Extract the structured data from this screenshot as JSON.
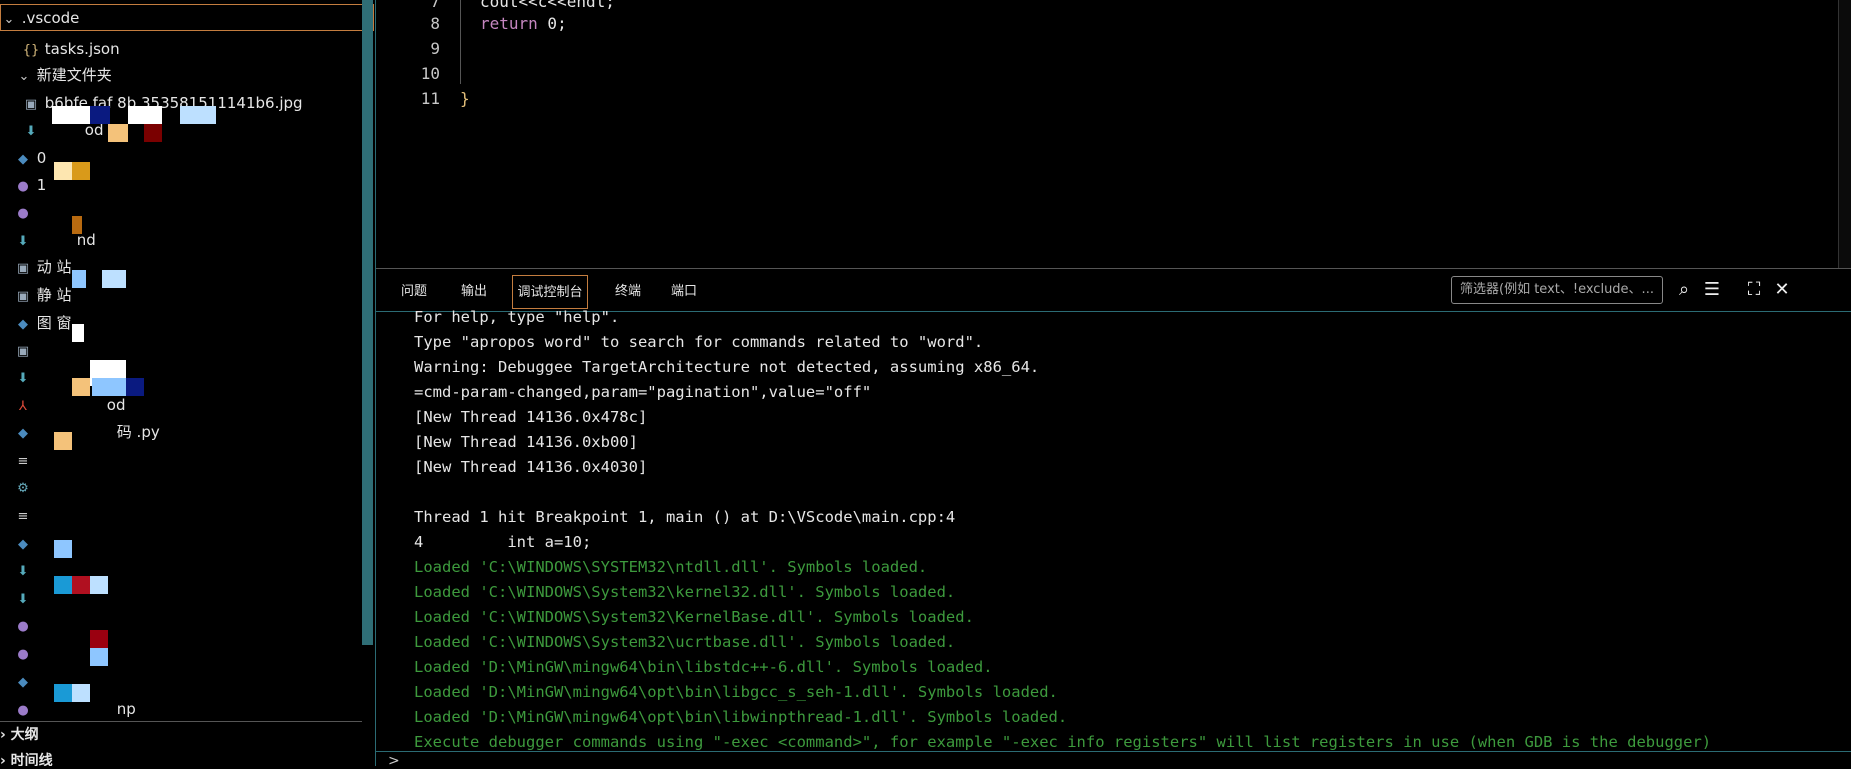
{
  "explorer": {
    "items": [
      {
        "label": ".vscode",
        "icon": "chevron-down-icon"
      },
      {
        "label": "tasks.json",
        "icon": "json-icon"
      },
      {
        "label": "新建文件夹",
        "icon": "chevron-down-icon"
      },
      {
        "label": "b6bfe  faf  8b  353581511141b6.jpg",
        "icon": "image-icon"
      },
      {
        "label": "od",
        "icon": "download-icon"
      },
      {
        "label": "0",
        "icon": "python-icon"
      },
      {
        "label": "1",
        "icon": "php-icon"
      },
      {
        "label": "nd",
        "icon": "download-icon"
      },
      {
        "label": "动  站",
        "icon": "image-icon"
      },
      {
        "label": "静  站",
        "icon": "image-icon"
      },
      {
        "label": "图  窗",
        "icon": "python-icon"
      },
      {
        "label": "od",
        "icon": "pdf-icon"
      },
      {
        "label": "码  .py",
        "icon": "python-icon"
      },
      {
        "label": "np",
        "icon": "php-icon"
      }
    ],
    "outline_label": "大纲",
    "timeline_label": "时间线"
  },
  "editor": {
    "lines": [
      {
        "num": "7",
        "text": "cout<<c<<endl;"
      },
      {
        "num": "8",
        "kw": "return",
        "rest": " 0;"
      },
      {
        "num": "9",
        "text": ""
      },
      {
        "num": "10",
        "text": ""
      },
      {
        "num": "11",
        "text": "}"
      }
    ]
  },
  "panel": {
    "tabs": [
      "问题",
      "输出",
      "调试控制台",
      "终端",
      "端口"
    ],
    "active_tab": "调试控制台",
    "filter_placeholder": "筛选器(例如 text、!exclude、...",
    "output": [
      {
        "text": "For help, type \"help\".",
        "color": "white"
      },
      {
        "text": "Type \"apropos word\" to search for commands related to \"word\".",
        "color": "white"
      },
      {
        "text": "Warning: Debuggee TargetArchitecture not detected, assuming x86_64.",
        "color": "white"
      },
      {
        "text": "=cmd-param-changed,param=\"pagination\",value=\"off\"",
        "color": "white"
      },
      {
        "text": "[New Thread 14136.0x478c]",
        "color": "white"
      },
      {
        "text": "[New Thread 14136.0xb00]",
        "color": "white"
      },
      {
        "text": "[New Thread 14136.0x4030]",
        "color": "white"
      },
      {
        "text": "",
        "color": "white"
      },
      {
        "text": "Thread 1 hit Breakpoint 1, main () at D:\\VScode\\main.cpp:4",
        "color": "white"
      },
      {
        "text": "4         int a=10;",
        "color": "white"
      },
      {
        "text": "Loaded 'C:\\WINDOWS\\SYSTEM32\\ntdll.dll'. Symbols loaded.",
        "color": "green"
      },
      {
        "text": "Loaded 'C:\\WINDOWS\\System32\\kernel32.dll'. Symbols loaded.",
        "color": "green"
      },
      {
        "text": "Loaded 'C:\\WINDOWS\\System32\\KernelBase.dll'. Symbols loaded.",
        "color": "green"
      },
      {
        "text": "Loaded 'C:\\WINDOWS\\System32\\ucrtbase.dll'. Symbols loaded.",
        "color": "green"
      },
      {
        "text": "Loaded 'D:\\MinGW\\mingw64\\bin\\libstdc++-6.dll'. Symbols loaded.",
        "color": "green"
      },
      {
        "text": "Loaded 'D:\\MinGW\\mingw64\\opt\\bin\\libgcc_s_seh-1.dll'. Symbols loaded.",
        "color": "green"
      },
      {
        "text": "Loaded 'D:\\MinGW\\mingw64\\opt\\bin\\libwinpthread-1.dll'. Symbols loaded.",
        "color": "green"
      },
      {
        "text": "Execute debugger commands using \"-exec <command>\", for example \"-exec info registers\" will list registers in use (when GDB is the debugger)",
        "color": "green"
      }
    ],
    "prompt": ">"
  },
  "colors": {
    "accent_border": "#c47d3f",
    "scrollbar": "#2f6e76",
    "loaded_green": "#3d9a3d",
    "keyword": "#c586c0"
  }
}
